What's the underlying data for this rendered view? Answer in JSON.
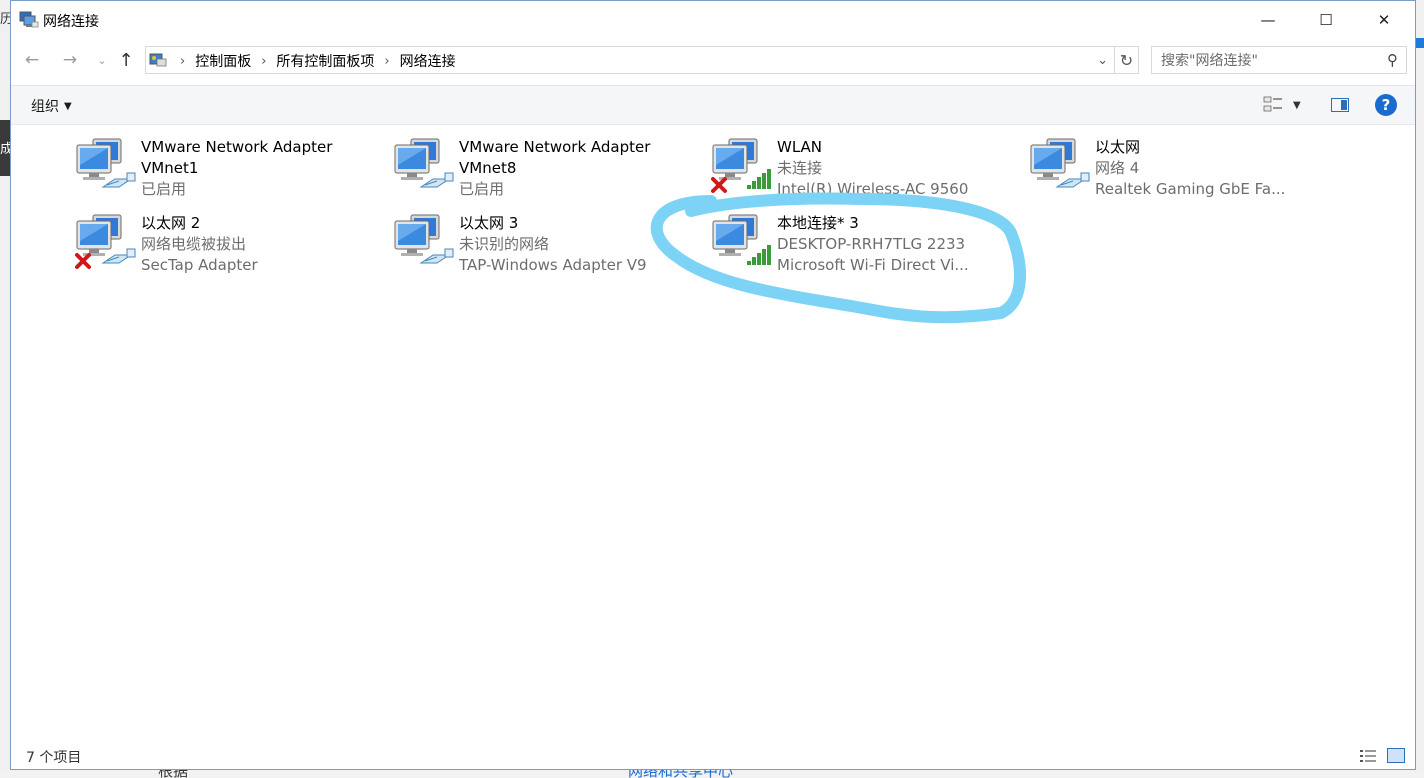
{
  "window": {
    "title": "网络连接",
    "buttons": {
      "minimize": "—",
      "maximize": "☐",
      "close": "✕"
    }
  },
  "nav": {
    "back": "←",
    "forward": "→",
    "recent": "⌄",
    "up": "↑",
    "breadcrumbs": [
      "控制面板",
      "所有控制面板项",
      "网络连接"
    ],
    "refresh": "↻",
    "dropdown": "⌄",
    "search_placeholder": "搜索\"网络连接\"",
    "search_icon": "⚲"
  },
  "toolbar": {
    "organize_label": "组织",
    "help_label": "?"
  },
  "items": [
    {
      "name": "VMware Network Adapter",
      "line1": "VMnet1",
      "line2": "已启用",
      "line1_is_name": true,
      "status": "ethernet"
    },
    {
      "name": "VMware Network Adapter",
      "line1": "VMnet8",
      "line2": "已启用",
      "line1_is_name": true,
      "status": "ethernet"
    },
    {
      "name": "WLAN",
      "line1": "未连接",
      "line2": "Intel(R) Wireless-AC 9560",
      "status": "wifi-disconnected"
    },
    {
      "name": "以太网",
      "line1": "网络 4",
      "line2": "Realtek Gaming GbE Fa...",
      "status": "ethernet"
    },
    {
      "name": "以太网 2",
      "line1": "网络电缆被拔出",
      "line2": "SecTap Adapter",
      "status": "ethernet-disconnected"
    },
    {
      "name": "以太网 3",
      "line1": "未识别的网络",
      "line2": "TAP-Windows Adapter V9",
      "status": "ethernet"
    },
    {
      "name": "本地连接* 3",
      "line1": "DESKTOP-RRH7TLG 2233",
      "line2": "Microsoft Wi-Fi Direct Vi...",
      "status": "wifi"
    }
  ],
  "status_bar": {
    "item_count": "7 个项目"
  },
  "background": {
    "left_glyph_top": "历",
    "left_glyph_mid": "成",
    "bottom_fragment_left": "根据",
    "bottom_fragment_right": "网络和共享中心"
  },
  "colors": {
    "highlight_circle": "#7dd3f5",
    "accent": "#1a6bd0"
  }
}
